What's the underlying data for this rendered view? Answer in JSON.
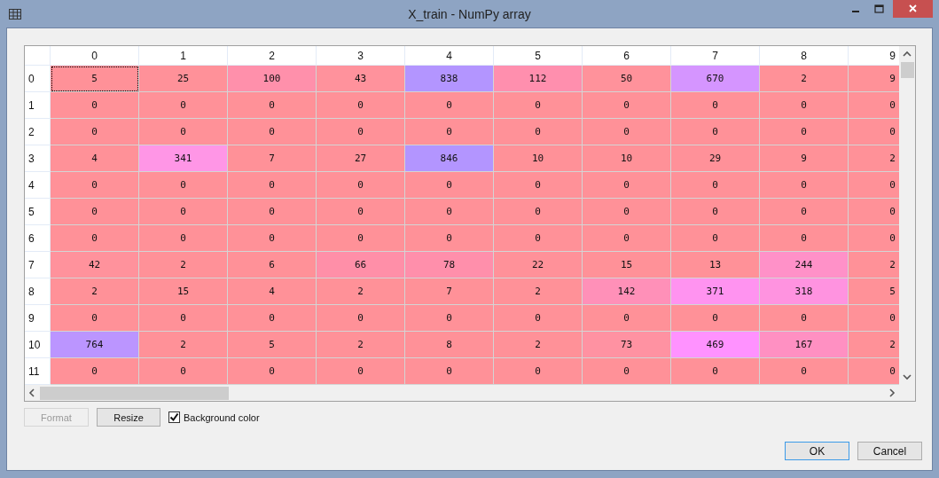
{
  "window": {
    "title": "X_train - NumPy array"
  },
  "table": {
    "columns": [
      "0",
      "1",
      "2",
      "3",
      "4",
      "5",
      "6",
      "7",
      "8",
      "9"
    ],
    "rows": [
      {
        "header": "0",
        "cells": [
          {
            "value": "5",
            "color": "#ff9198",
            "selected": true
          },
          {
            "value": "25",
            "color": "#ff9199",
            "selected": false
          },
          {
            "value": "100",
            "color": "#ff90ab",
            "selected": false
          },
          {
            "value": "43",
            "color": "#ff929c",
            "selected": false
          },
          {
            "value": "838",
            "color": "#b395ff",
            "selected": false
          },
          {
            "value": "112",
            "color": "#ff8fae",
            "selected": false
          },
          {
            "value": "50",
            "color": "#ff929b",
            "selected": false
          },
          {
            "value": "670",
            "color": "#d595ff",
            "selected": false
          },
          {
            "value": "2",
            "color": "#ff9198",
            "selected": false
          },
          {
            "value": "9",
            "color": "#ff9198",
            "selected": false
          }
        ]
      },
      {
        "header": "1",
        "cells": [
          {
            "value": "0",
            "color": "#ff9198",
            "selected": false
          },
          {
            "value": "0",
            "color": "#ff9198",
            "selected": false
          },
          {
            "value": "0",
            "color": "#ff9198",
            "selected": false
          },
          {
            "value": "0",
            "color": "#ff9198",
            "selected": false
          },
          {
            "value": "0",
            "color": "#ff9198",
            "selected": false
          },
          {
            "value": "0",
            "color": "#ff9198",
            "selected": false
          },
          {
            "value": "0",
            "color": "#ff9198",
            "selected": false
          },
          {
            "value": "0",
            "color": "#ff9198",
            "selected": false
          },
          {
            "value": "0",
            "color": "#ff9198",
            "selected": false
          },
          {
            "value": "0",
            "color": "#ff9198",
            "selected": false
          }
        ]
      },
      {
        "header": "2",
        "cells": [
          {
            "value": "0",
            "color": "#ff9198",
            "selected": false
          },
          {
            "value": "0",
            "color": "#ff9198",
            "selected": false
          },
          {
            "value": "0",
            "color": "#ff9198",
            "selected": false
          },
          {
            "value": "0",
            "color": "#ff9198",
            "selected": false
          },
          {
            "value": "0",
            "color": "#ff9198",
            "selected": false
          },
          {
            "value": "0",
            "color": "#ff9198",
            "selected": false
          },
          {
            "value": "0",
            "color": "#ff9198",
            "selected": false
          },
          {
            "value": "0",
            "color": "#ff9198",
            "selected": false
          },
          {
            "value": "0",
            "color": "#ff9198",
            "selected": false
          },
          {
            "value": "0",
            "color": "#ff9198",
            "selected": false
          }
        ]
      },
      {
        "header": "3",
        "cells": [
          {
            "value": "4",
            "color": "#ff9198",
            "selected": false
          },
          {
            "value": "341",
            "color": "#ff96e6",
            "selected": false
          },
          {
            "value": "7",
            "color": "#ff9198",
            "selected": false
          },
          {
            "value": "27",
            "color": "#ff9199",
            "selected": false
          },
          {
            "value": "846",
            "color": "#b395ff",
            "selected": false
          },
          {
            "value": "10",
            "color": "#ff9198",
            "selected": false
          },
          {
            "value": "10",
            "color": "#ff9198",
            "selected": false
          },
          {
            "value": "29",
            "color": "#ff9199",
            "selected": false
          },
          {
            "value": "9",
            "color": "#ff9198",
            "selected": false
          },
          {
            "value": "2",
            "color": "#ff9198",
            "selected": false
          }
        ]
      },
      {
        "header": "4",
        "cells": [
          {
            "value": "0",
            "color": "#ff9198",
            "selected": false
          },
          {
            "value": "0",
            "color": "#ff9198",
            "selected": false
          },
          {
            "value": "0",
            "color": "#ff9198",
            "selected": false
          },
          {
            "value": "0",
            "color": "#ff9198",
            "selected": false
          },
          {
            "value": "0",
            "color": "#ff9198",
            "selected": false
          },
          {
            "value": "0",
            "color": "#ff9198",
            "selected": false
          },
          {
            "value": "0",
            "color": "#ff9198",
            "selected": false
          },
          {
            "value": "0",
            "color": "#ff9198",
            "selected": false
          },
          {
            "value": "0",
            "color": "#ff9198",
            "selected": false
          },
          {
            "value": "0",
            "color": "#ff9198",
            "selected": false
          }
        ]
      },
      {
        "header": "5",
        "cells": [
          {
            "value": "0",
            "color": "#ff9198",
            "selected": false
          },
          {
            "value": "0",
            "color": "#ff9198",
            "selected": false
          },
          {
            "value": "0",
            "color": "#ff9198",
            "selected": false
          },
          {
            "value": "0",
            "color": "#ff9198",
            "selected": false
          },
          {
            "value": "0",
            "color": "#ff9198",
            "selected": false
          },
          {
            "value": "0",
            "color": "#ff9198",
            "selected": false
          },
          {
            "value": "0",
            "color": "#ff9198",
            "selected": false
          },
          {
            "value": "0",
            "color": "#ff9198",
            "selected": false
          },
          {
            "value": "0",
            "color": "#ff9198",
            "selected": false
          },
          {
            "value": "0",
            "color": "#ff9198",
            "selected": false
          }
        ]
      },
      {
        "header": "6",
        "cells": [
          {
            "value": "0",
            "color": "#ff9198",
            "selected": false
          },
          {
            "value": "0",
            "color": "#ff9198",
            "selected": false
          },
          {
            "value": "0",
            "color": "#ff9198",
            "selected": false
          },
          {
            "value": "0",
            "color": "#ff9198",
            "selected": false
          },
          {
            "value": "0",
            "color": "#ff9198",
            "selected": false
          },
          {
            "value": "0",
            "color": "#ff9198",
            "selected": false
          },
          {
            "value": "0",
            "color": "#ff9198",
            "selected": false
          },
          {
            "value": "0",
            "color": "#ff9198",
            "selected": false
          },
          {
            "value": "0",
            "color": "#ff9198",
            "selected": false
          },
          {
            "value": "0",
            "color": "#ff9198",
            "selected": false
          }
        ]
      },
      {
        "header": "7",
        "cells": [
          {
            "value": "42",
            "color": "#ff929c",
            "selected": false
          },
          {
            "value": "2",
            "color": "#ff9198",
            "selected": false
          },
          {
            "value": "6",
            "color": "#ff9198",
            "selected": false
          },
          {
            "value": "66",
            "color": "#ff8fa8",
            "selected": false
          },
          {
            "value": "78",
            "color": "#ff8fab",
            "selected": false
          },
          {
            "value": "22",
            "color": "#ff9199",
            "selected": false
          },
          {
            "value": "15",
            "color": "#ff9198",
            "selected": false
          },
          {
            "value": "13",
            "color": "#ff9198",
            "selected": false
          },
          {
            "value": "244",
            "color": "#ff91c8",
            "selected": false
          },
          {
            "value": "2",
            "color": "#ff9198",
            "selected": false
          }
        ]
      },
      {
        "header": "8",
        "cells": [
          {
            "value": "2",
            "color": "#ff9198",
            "selected": false
          },
          {
            "value": "15",
            "color": "#ff9198",
            "selected": false
          },
          {
            "value": "4",
            "color": "#ff9198",
            "selected": false
          },
          {
            "value": "2",
            "color": "#ff9198",
            "selected": false
          },
          {
            "value": "7",
            "color": "#ff9198",
            "selected": false
          },
          {
            "value": "2",
            "color": "#ff9198",
            "selected": false
          },
          {
            "value": "142",
            "color": "#ff90b8",
            "selected": false
          },
          {
            "value": "371",
            "color": "#ff93f0",
            "selected": false
          },
          {
            "value": "318",
            "color": "#ff93e0",
            "selected": false
          },
          {
            "value": "5",
            "color": "#ff9198",
            "selected": false
          }
        ]
      },
      {
        "header": "9",
        "cells": [
          {
            "value": "0",
            "color": "#ff9198",
            "selected": false
          },
          {
            "value": "0",
            "color": "#ff9198",
            "selected": false
          },
          {
            "value": "0",
            "color": "#ff9198",
            "selected": false
          },
          {
            "value": "0",
            "color": "#ff9198",
            "selected": false
          },
          {
            "value": "0",
            "color": "#ff9198",
            "selected": false
          },
          {
            "value": "0",
            "color": "#ff9198",
            "selected": false
          },
          {
            "value": "0",
            "color": "#ff9198",
            "selected": false
          },
          {
            "value": "0",
            "color": "#ff9198",
            "selected": false
          },
          {
            "value": "0",
            "color": "#ff9198",
            "selected": false
          },
          {
            "value": "0",
            "color": "#ff9198",
            "selected": false
          }
        ]
      },
      {
        "header": "10",
        "cells": [
          {
            "value": "764",
            "color": "#bb95ff",
            "selected": false
          },
          {
            "value": "2",
            "color": "#ff9198",
            "selected": false
          },
          {
            "value": "5",
            "color": "#ff9198",
            "selected": false
          },
          {
            "value": "2",
            "color": "#ff9198",
            "selected": false
          },
          {
            "value": "8",
            "color": "#ff9198",
            "selected": false
          },
          {
            "value": "2",
            "color": "#ff9198",
            "selected": false
          },
          {
            "value": "73",
            "color": "#ff92a2",
            "selected": false
          },
          {
            "value": "469",
            "color": "#ff92ff",
            "selected": false
          },
          {
            "value": "167",
            "color": "#ff90c2",
            "selected": false
          },
          {
            "value": "2",
            "color": "#ff9198",
            "selected": false
          }
        ]
      },
      {
        "header": "11",
        "cells": [
          {
            "value": "0",
            "color": "#ff9198",
            "selected": false
          },
          {
            "value": "0",
            "color": "#ff9198",
            "selected": false
          },
          {
            "value": "0",
            "color": "#ff9198",
            "selected": false
          },
          {
            "value": "0",
            "color": "#ff9198",
            "selected": false
          },
          {
            "value": "0",
            "color": "#ff9198",
            "selected": false
          },
          {
            "value": "0",
            "color": "#ff9198",
            "selected": false
          },
          {
            "value": "0",
            "color": "#ff9198",
            "selected": false
          },
          {
            "value": "0",
            "color": "#ff9198",
            "selected": false
          },
          {
            "value": "0",
            "color": "#ff9198",
            "selected": false
          },
          {
            "value": "0",
            "color": "#ff9198",
            "selected": false
          }
        ]
      }
    ]
  },
  "controls": {
    "format_button": {
      "label": "Format",
      "disabled": true
    },
    "resize_button": {
      "label": "Resize",
      "disabled": false
    },
    "background_color": {
      "label": "Background color",
      "checked": true
    }
  },
  "buttons": [
    {
      "label": "OK",
      "default": true
    },
    {
      "label": "Cancel",
      "default": false
    }
  ]
}
